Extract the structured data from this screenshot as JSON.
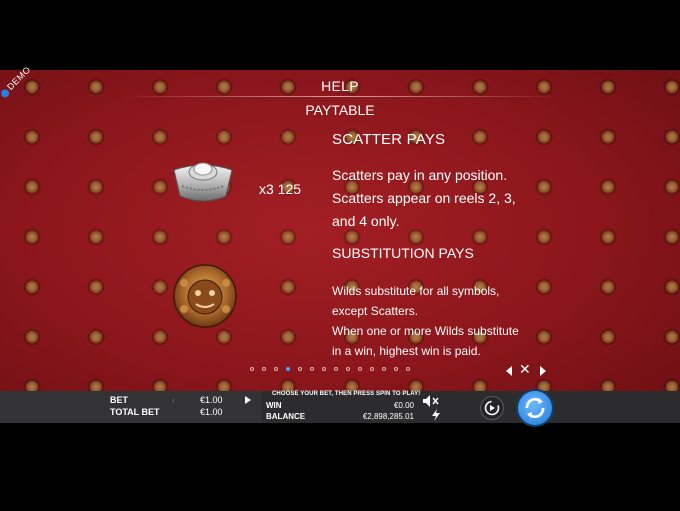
{
  "badge": {
    "demo": "DEMO"
  },
  "header": {
    "help": "HELP",
    "paytable": "PAYTABLE"
  },
  "scatter": {
    "multiplier": "x3 125",
    "heading": "SCATTER PAYS",
    "lines": [
      "Scatters pay in any position.",
      "Scatters appear on reels 2, 3,",
      "and 4 only."
    ]
  },
  "substitution": {
    "heading": "SUBSTITUTION PAYS",
    "lines": [
      "Wilds substitute for all symbols,",
      "except Scatters.",
      "When one or more Wilds substitute",
      "in a win, highest win is paid."
    ]
  },
  "pagination": {
    "total": 14,
    "active": 3
  },
  "bottom_bar": {
    "bet_label": "BET",
    "bet_value": "€1.00",
    "total_bet_label": "TOTAL BET",
    "total_bet_value": "€1.00",
    "message": "CHOOSE YOUR BET, THEN PRESS SPIN TO PLAY!",
    "win_label": "WIN",
    "win_value": "€0.00",
    "balance_label": "BALANCE",
    "balance_value": "€2,898,285.01"
  },
  "icons": {
    "scatter_symbol": "silver-ingot-icon",
    "wild_symbol": "golden-lion-icon",
    "prev": "arrow-left-icon",
    "close": "close-icon",
    "next": "arrow-right-icon",
    "sound": "speaker-muted-icon",
    "turbo": "lightning-icon",
    "autoplay": "autoplay-icon",
    "spin": "spin-icon"
  },
  "colors": {
    "background_red": "#8a161b",
    "accent_blue": "#2a8be8",
    "bar": "#2c2c2e"
  }
}
